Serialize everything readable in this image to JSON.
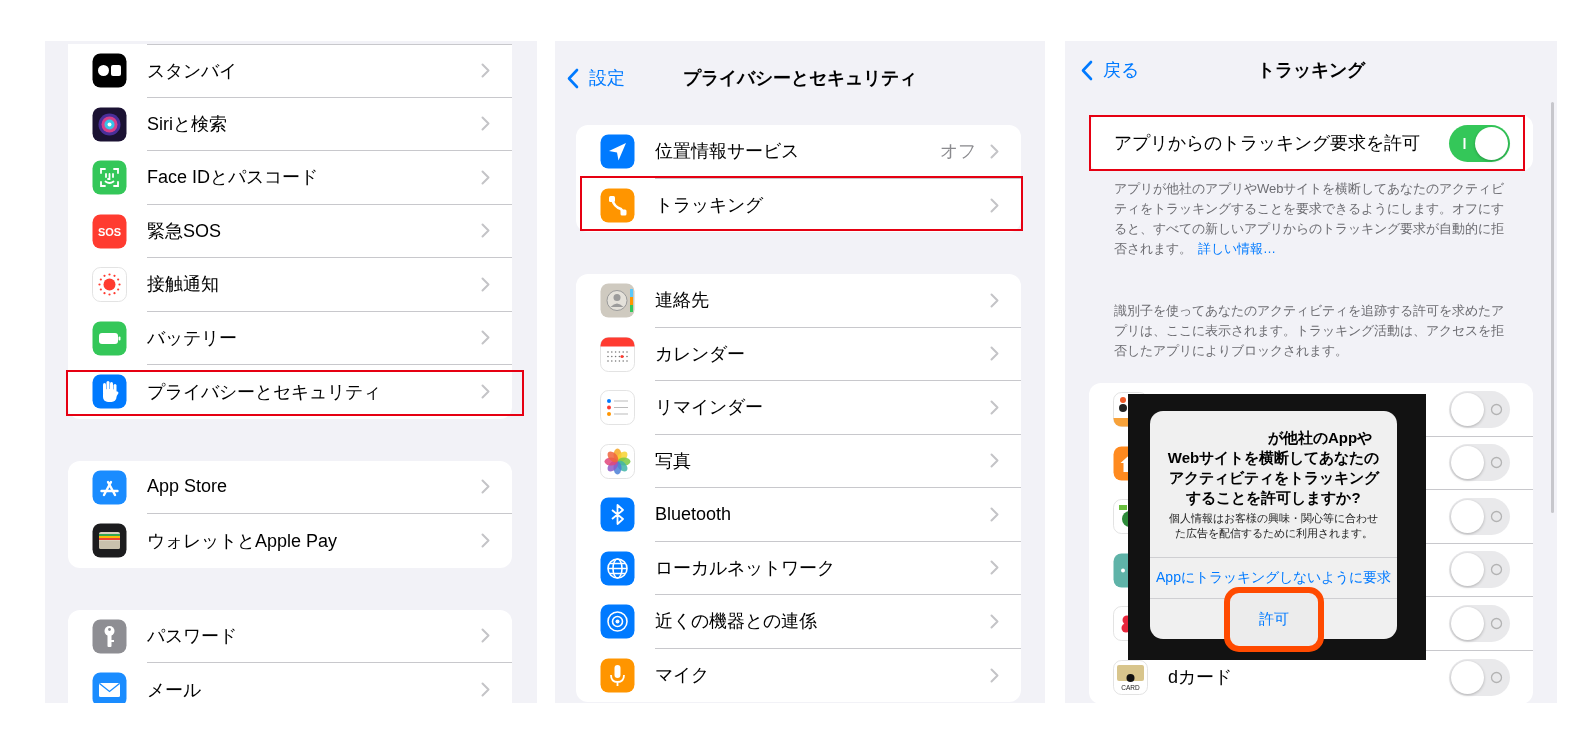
{
  "settings_screen": {
    "groups": [
      {
        "rows": [
          {
            "label": "スタンバイ",
            "highlighted": false
          },
          {
            "label": "Siriと検索",
            "highlighted": false
          },
          {
            "label": "Face IDとパスコード",
            "highlighted": false
          },
          {
            "label": "緊急SOS",
            "highlighted": false,
            "icon_text": "SOS"
          },
          {
            "label": "接触通知",
            "highlighted": false
          },
          {
            "label": "バッテリー",
            "highlighted": false
          },
          {
            "label": "プライバシーとセキュリティ",
            "highlighted": true
          }
        ]
      },
      {
        "rows": [
          {
            "label": "App Store",
            "highlighted": false
          },
          {
            "label": "ウォレットとApple Pay",
            "highlighted": false
          }
        ]
      },
      {
        "rows": [
          {
            "label": "パスワード",
            "highlighted": false
          },
          {
            "label": "メール",
            "highlighted": false
          }
        ]
      }
    ]
  },
  "privacy_screen": {
    "back": "設定",
    "title": "プライバシーとセキュリティ",
    "groups": [
      {
        "rows": [
          {
            "label": "位置情報サービス",
            "value": "オフ",
            "highlighted": false
          },
          {
            "label": "トラッキング",
            "highlighted": true
          }
        ]
      },
      {
        "rows": [
          {
            "label": "連絡先",
            "highlighted": false
          },
          {
            "label": "カレンダー",
            "highlighted": false
          },
          {
            "label": "リマインダー",
            "highlighted": false
          },
          {
            "label": "写真",
            "highlighted": false
          },
          {
            "label": "Bluetooth",
            "highlighted": false
          },
          {
            "label": "ローカルネットワーク",
            "highlighted": false
          },
          {
            "label": "近くの機器との連係",
            "highlighted": false
          },
          {
            "label": "マイク",
            "highlighted": false
          }
        ]
      }
    ]
  },
  "tracking_screen": {
    "back": "戻る",
    "title": "トラッキング",
    "allow_row": {
      "label": "アプリからのトラッキング要求を許可",
      "on": true,
      "highlighted": true
    },
    "description": "アプリが他社のアプリやWebサイトを横断してあなたのアクティビティをトラッキングすることを要求できるようにします。オフにすると、すべての新しいアプリからのトラッキング要求が自動的に拒否されます。",
    "link": "詳しい情報…",
    "note": "識別子を使ってあなたのアクティビティを追跡する許可を求めたアプリは、ここに表示されます。トラッキング活動は、アクセスを拒否したアプリによりブロックされます。",
    "apps": [
      {
        "on": false
      },
      {
        "on": false
      },
      {
        "on": false
      },
      {
        "on": false
      },
      {
        "on": false
      },
      {
        "label": "dカード",
        "icon_text": "CARD",
        "on": false
      }
    ],
    "dialog": {
      "title": "が他社のAppやWebサイトを横断してあなたのアクティビティをトラッキングすることを許可しますか?",
      "message": "個人情報はお客様の興味・関心等に合わせた広告を配信するために利用されます。",
      "buttons": [
        {
          "label": "Appにトラッキングしないように要求",
          "highlighted": false
        },
        {
          "label": "許可",
          "highlighted": true
        }
      ]
    }
  }
}
